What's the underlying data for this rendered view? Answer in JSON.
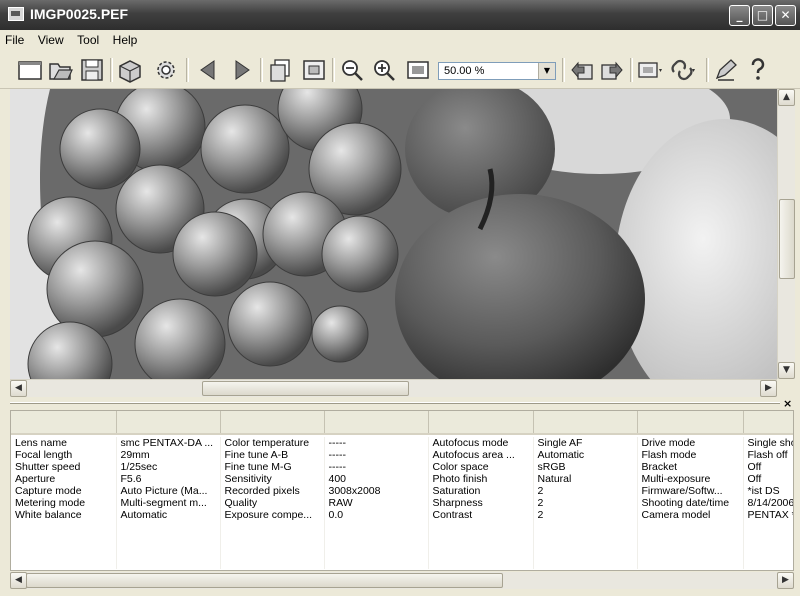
{
  "window": {
    "title": "IMGP0025.PEF"
  },
  "menu": [
    "File",
    "View",
    "Tool",
    "Help"
  ],
  "toolbar": {
    "icons": [
      "new-window-icon",
      "open-icon",
      "save-icon",
      "box-icon",
      "settings-icon",
      "previous-icon",
      "next-icon",
      "copy-icon",
      "fit-window-icon",
      "zoom-out-icon",
      "zoom-in-icon",
      "actual-size-icon",
      "rotate-left-icon",
      "rotate-right-icon",
      "compare-icon",
      "link-icon",
      "edit-icon",
      "help-icon"
    ],
    "zoom_value": "50.00 %"
  },
  "info": {
    "rows": [
      [
        "Lens name",
        "smc PENTAX-DA ...",
        "Color temperature",
        "-----",
        "Autofocus mode",
        "Single AF",
        "Drive mode",
        "Single shot"
      ],
      [
        "Focal length",
        "29mm",
        "Fine tune A-B",
        "-----",
        "Autofocus area ...",
        "Automatic",
        "Flash mode",
        "Flash off"
      ],
      [
        "Shutter speed",
        "1/25sec",
        "Fine tune M-G",
        "-----",
        "Color space",
        "sRGB",
        "Bracket",
        "Off"
      ],
      [
        "Aperture",
        "F5.6",
        "Sensitivity",
        "400",
        "Photo finish",
        "Natural",
        "Multi-exposure",
        "Off"
      ],
      [
        "Capture mode",
        "Auto Picture (Ma...",
        "Recorded pixels",
        "3008x2008",
        "Saturation",
        "2",
        "Firmware/Softw...",
        "*ist DS"
      ],
      [
        "Metering mode",
        "Multi-segment m...",
        "Quality",
        "RAW",
        "Sharpness",
        "2",
        "Shooting date/time",
        "8/14/2006"
      ],
      [
        "White balance",
        "Automatic",
        "Exposure compe...",
        "0.0",
        "Contrast",
        "2",
        "Camera model",
        "PENTAX *ist DS"
      ]
    ]
  }
}
